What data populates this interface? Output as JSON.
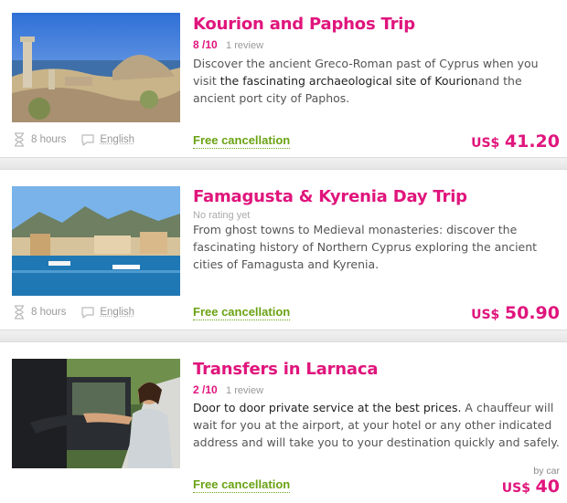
{
  "tours": [
    {
      "title": "Kourion and Paphos Trip",
      "rating": "8 /10",
      "reviews": "1 review",
      "desc_pre": "Discover the ancient Greco-Roman past of Cyprus when you visit ",
      "desc_bold": "the fascinating archaeological site of Kourion",
      "desc_post": "and the ancient port city of Paphos.",
      "duration": "8 hours",
      "language": "English",
      "cancellation": "Free cancellation",
      "currency": "US$",
      "price": "41.20",
      "image_icon": "ruins-photo"
    },
    {
      "title": "Famagusta & Kyrenia Day Trip",
      "rating_text": "No rating yet",
      "desc": "From ghost towns to Medieval monasteries: discover the fascinating history of Northern Cyprus exploring the ancient cities of Famagusta and Kyrenia.",
      "duration": "8 hours",
      "language": "English",
      "cancellation": "Free cancellation",
      "currency": "US$",
      "price": "50.90",
      "image_icon": "harbor-photo"
    },
    {
      "title": "Transfers in Larnaca",
      "rating": "2 /10",
      "reviews": "1 review",
      "desc_bold": "Door to door private service at the best prices.",
      "desc_post": " A chauffeur will wait for you at the airport, at your hotel or any other indicated address and will take you to your destination quickly and safely.",
      "cancellation": "Free cancellation",
      "price_note": "by car",
      "currency": "US$",
      "price": "40",
      "image_icon": "chauffeur-photo"
    }
  ],
  "icons": {
    "duration": "hourglass-icon",
    "language": "speech-bubble-icon"
  },
  "colors": {
    "accent": "#e0157c",
    "green": "#6aa213"
  }
}
